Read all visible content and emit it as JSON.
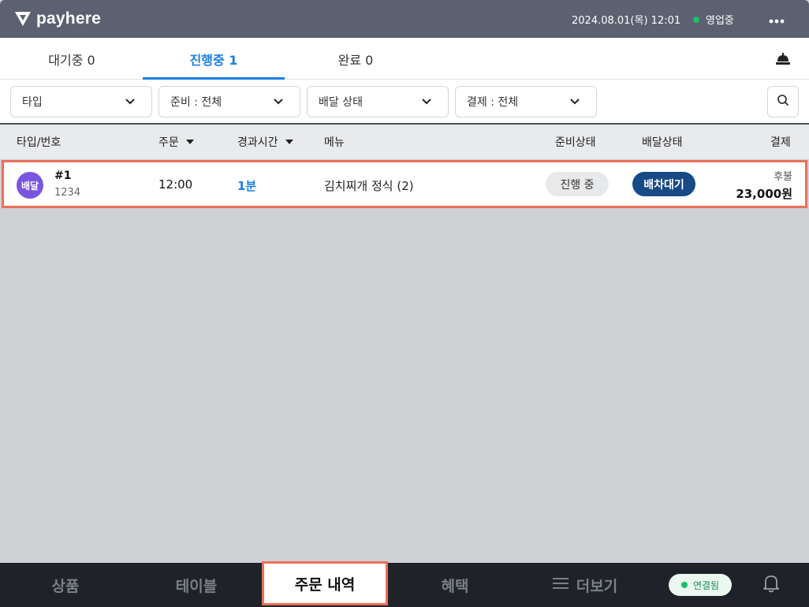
{
  "app": {
    "brand": "payhere"
  },
  "topbar": {
    "datetime": "2024.08.01(목) 12:01",
    "status": "영업중"
  },
  "tabs": [
    {
      "label": "대기중 0"
    },
    {
      "label": "진행중 1",
      "active": true
    },
    {
      "label": "완료 0"
    }
  ],
  "filters": {
    "type": "타입",
    "prep": "준비 : 전체",
    "delivery": "배달 상태",
    "payment": "결제 : 전체"
  },
  "table": {
    "headers": {
      "type_num": "타입/번호",
      "order": "주문",
      "elapsed": "경과시간",
      "menu": "메뉴",
      "prep_status": "준비상태",
      "delivery_status": "배달상태",
      "payment": "결제"
    },
    "rows": [
      {
        "type_badge": "배달",
        "number": "#1",
        "sub": "1234",
        "time": "12:00",
        "elapsed": "1분",
        "menu": "김치찌개 정식 (2)",
        "prep_status": "진행 중",
        "delivery_status": "배차대기",
        "payment_type": "후불",
        "amount": "23,000원"
      }
    ]
  },
  "bottom_nav": {
    "items": [
      "상품",
      "테이블",
      "주문 내역",
      "혜택",
      "더보기"
    ],
    "active_index": 2,
    "connection": "연결됨"
  },
  "colors": {
    "topbar": "#5b6170",
    "accent": "#1a7fe0",
    "highlight_border": "#ea6f5a",
    "badge_purple": "#7a55e0",
    "delivery_pill": "#174a86",
    "online_green": "#1bbf6b"
  },
  "icons": [
    "payhere-logo-icon",
    "more-icon",
    "counter-bell-icon",
    "chevron-down-icon",
    "search-icon",
    "menu-lines-icon",
    "bell-icon"
  ]
}
